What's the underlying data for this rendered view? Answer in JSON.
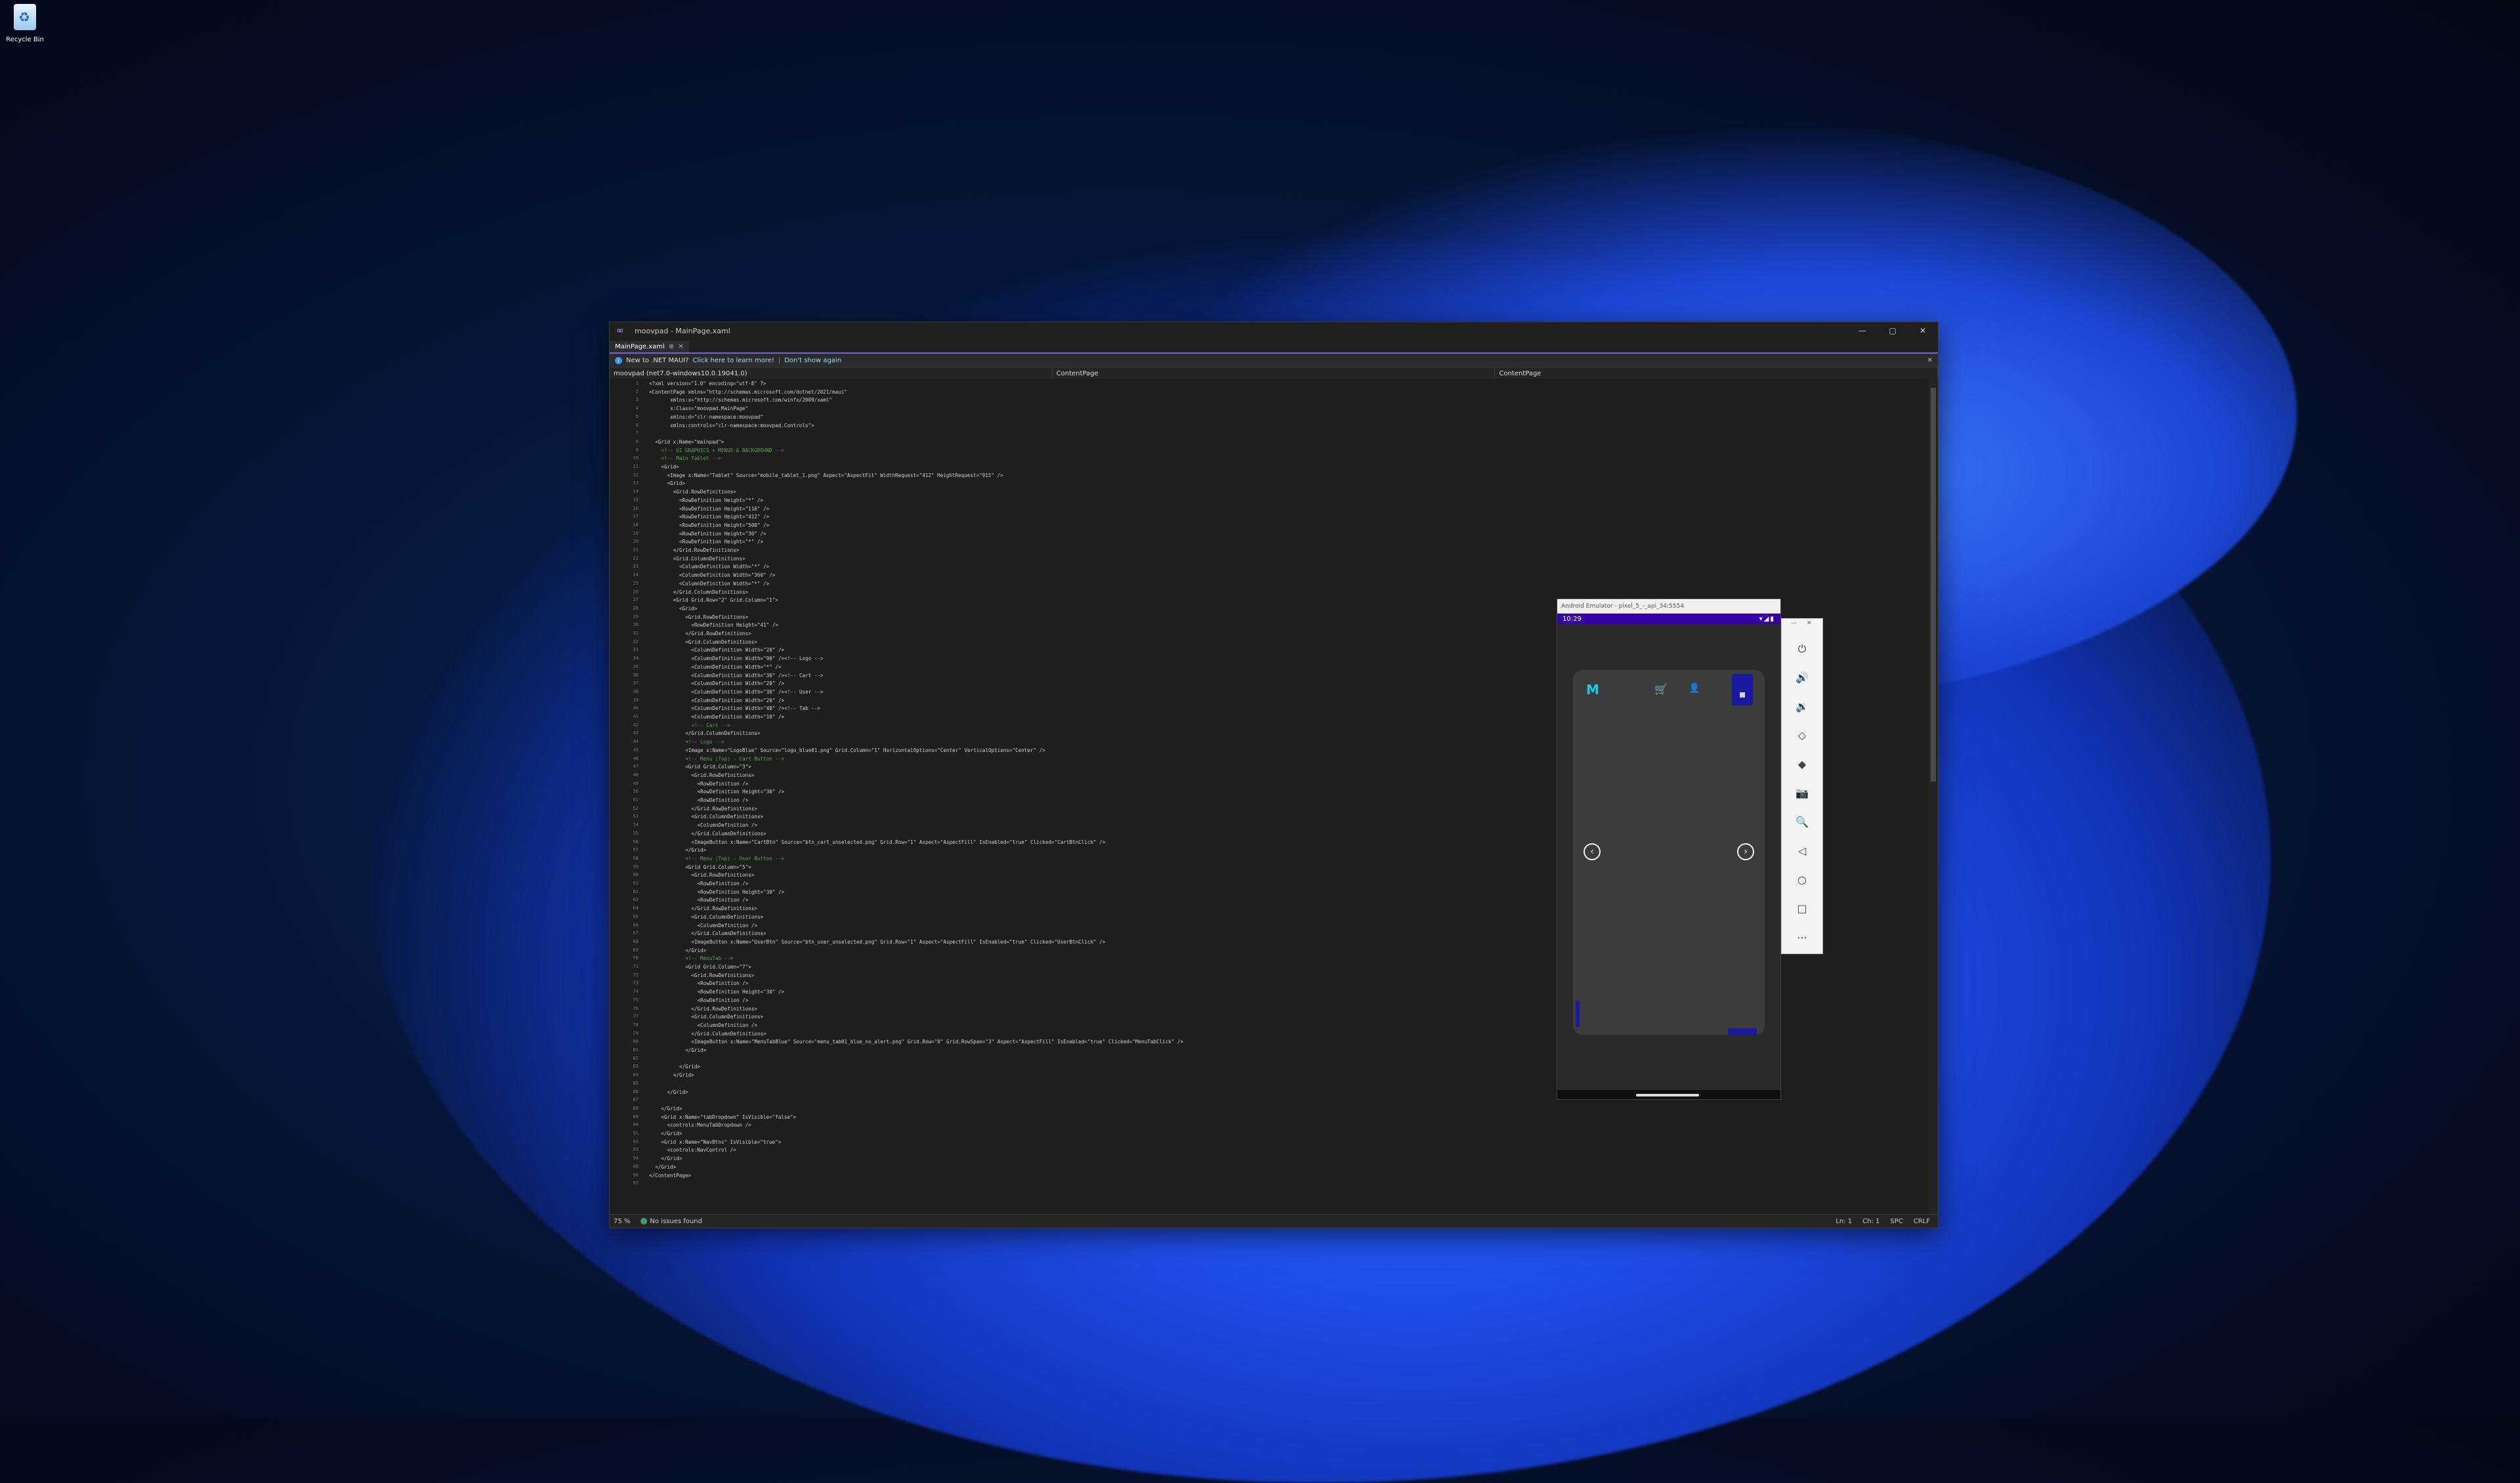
{
  "desktop": {
    "recycle_bin_label": "Recycle Bin"
  },
  "window": {
    "title": "moovpad - MainPage.xaml",
    "tab_label": "MainPage.xaml",
    "infobar": {
      "message": "New to .NET MAUI?",
      "link1": "Click here to learn more!",
      "separator": "|",
      "link2": "Don't show again"
    },
    "nav": {
      "project": "moovpad (net7.0-windows10.0.19041.0)",
      "type": "ContentPage",
      "member": "ContentPage"
    },
    "status": {
      "zoom": "75 %",
      "issues": "No issues found",
      "line": "Ln: 1",
      "col": "Ch: 1",
      "spc": "SPC",
      "eol": "CRLF"
    }
  },
  "code_lines": [
    {
      "n": "1",
      "t": "<?xml version=\"1.0\" encoding=\"utf-8\" ?>",
      "i": 0,
      "c": "tag"
    },
    {
      "n": "2",
      "t": "<ContentPage xmlns=\"http://schemas.microsoft.com/dotnet/2021/maui\"",
      "i": 0,
      "c": "tag"
    },
    {
      "n": "3",
      "t": "xmlns:x=\"http://schemas.microsoft.com/winfx/2009/xaml\"",
      "i": 7,
      "c": "tag"
    },
    {
      "n": "4",
      "t": "x:Class=\"moovpad.MainPage\"",
      "i": 7,
      "c": "tag"
    },
    {
      "n": "5",
      "t": "xmlns:d=\"clr-namespace:moovpad\"",
      "i": 7,
      "c": "tag"
    },
    {
      "n": "6",
      "t": "xmlns:controls=\"clr-namespace:moovpad.Controls\">",
      "i": 7,
      "c": "tag"
    },
    {
      "n": "7",
      "t": "",
      "i": 0,
      "c": "tag"
    },
    {
      "n": "8",
      "t": "<Grid x:Name=\"mainpad\">",
      "i": 2,
      "c": "tag"
    },
    {
      "n": "9",
      "t": "<!-- UI GRAPHICS + MENUS & BACKGROUND -->",
      "i": 4,
      "c": "cm"
    },
    {
      "n": "10",
      "t": "<!-- Main Tablet -->",
      "i": 4,
      "c": "cm"
    },
    {
      "n": "11",
      "t": "<Grid>",
      "i": 4,
      "c": "tag"
    },
    {
      "n": "12",
      "t": "<Image x:Name=\"Tablet\" Source=\"mobile_tablet_1.png\" Aspect=\"AspectFit\" WidthRequest=\"412\" HeightRequest=\"915\" />",
      "i": 6,
      "c": "tag"
    },
    {
      "n": "13",
      "t": "<Grid>",
      "i": 6,
      "c": "tag"
    },
    {
      "n": "14",
      "t": "<Grid.RowDefinitions>",
      "i": 8,
      "c": "tag"
    },
    {
      "n": "15",
      "t": "<RowDefinition Height=\"*\" />",
      "i": 10,
      "c": "tag"
    },
    {
      "n": "16",
      "t": "<RowDefinition Height=\"116\" />",
      "i": 10,
      "c": "tag"
    },
    {
      "n": "17",
      "t": "<RowDefinition Height=\"412\" />",
      "i": 10,
      "c": "tag"
    },
    {
      "n": "18",
      "t": "<RowDefinition Height=\"500\" />",
      "i": 10,
      "c": "tag"
    },
    {
      "n": "19",
      "t": "<RowDefinition Height=\"30\" />",
      "i": 10,
      "c": "tag"
    },
    {
      "n": "20",
      "t": "<RowDefinition Height=\"*\" />",
      "i": 10,
      "c": "tag"
    },
    {
      "n": "21",
      "t": "</Grid.RowDefinitions>",
      "i": 8,
      "c": "tag"
    },
    {
      "n": "22",
      "t": "<Grid.ColumnDefinitions>",
      "i": 8,
      "c": "tag"
    },
    {
      "n": "23",
      "t": "<ColumnDefinition Width=\"*\" />",
      "i": 10,
      "c": "tag"
    },
    {
      "n": "24",
      "t": "<ColumnDefinition Width=\"360\" />",
      "i": 10,
      "c": "tag"
    },
    {
      "n": "25",
      "t": "<ColumnDefinition Width=\"*\" />",
      "i": 10,
      "c": "tag"
    },
    {
      "n": "26",
      "t": "</Grid.ColumnDefinitions>",
      "i": 8,
      "c": "tag"
    },
    {
      "n": "27",
      "t": "<Grid Grid.Row=\"2\" Grid.Column=\"1\">",
      "i": 8,
      "c": "tag"
    },
    {
      "n": "28",
      "t": "<Grid>",
      "i": 10,
      "c": "tag"
    },
    {
      "n": "29",
      "t": "<Grid.RowDefinitions>",
      "i": 12,
      "c": "tag"
    },
    {
      "n": "30",
      "t": "<RowDefinition Height=\"41\" />",
      "i": 14,
      "c": "tag"
    },
    {
      "n": "31",
      "t": "</Grid.RowDefinitions>",
      "i": 12,
      "c": "tag"
    },
    {
      "n": "32",
      "t": "<Grid.ColumnDefinitions>",
      "i": 12,
      "c": "tag"
    },
    {
      "n": "33",
      "t": "<ColumnDefinition Width=\"20\" />",
      "i": 14,
      "c": "tag"
    },
    {
      "n": "34",
      "t": "<ColumnDefinition Width=\"90\" /><!-- Logo -->",
      "i": 14,
      "c": "tag"
    },
    {
      "n": "35",
      "t": "<ColumnDefinition Width=\"*\" />",
      "i": 14,
      "c": "tag"
    },
    {
      "n": "36",
      "t": "<ColumnDefinition Width=\"30\" /><!-- Cart -->",
      "i": 14,
      "c": "tag"
    },
    {
      "n": "37",
      "t": "<ColumnDefinition Width=\"20\" />",
      "i": 14,
      "c": "tag"
    },
    {
      "n": "38",
      "t": "<ColumnDefinition Width=\"30\" /><!-- User -->",
      "i": 14,
      "c": "tag"
    },
    {
      "n": "39",
      "t": "<ColumnDefinition Width=\"20\" />",
      "i": 14,
      "c": "tag"
    },
    {
      "n": "40",
      "t": "<ColumnDefinition Width=\"40\" /><!-- Tab -->",
      "i": 14,
      "c": "tag"
    },
    {
      "n": "41",
      "t": "<ColumnDefinition Width=\"10\" />",
      "i": 14,
      "c": "tag"
    },
    {
      "n": "42",
      "t": "<!-- Cart -->",
      "i": 14,
      "c": "cm"
    },
    {
      "n": "43",
      "t": "</Grid.ColumnDefinitions>",
      "i": 12,
      "c": "tag"
    },
    {
      "n": "44",
      "t": "<!-- Logo -->",
      "i": 12,
      "c": "cm"
    },
    {
      "n": "45",
      "t": "<Image x:Name=\"LogoBlue\" Source=\"logo_blue01.png\" Grid.Column=\"1\" HorizontalOptions=\"Center\" VerticalOptions=\"Center\" />",
      "i": 12,
      "c": "tag"
    },
    {
      "n": "46",
      "t": "<!-- Menu (Top) - Cart Button -->",
      "i": 12,
      "c": "cm"
    },
    {
      "n": "47",
      "t": "<Grid Grid.Column=\"3\">",
      "i": 12,
      "c": "tag"
    },
    {
      "n": "48",
      "t": "<Grid.RowDefinitions>",
      "i": 14,
      "c": "tag"
    },
    {
      "n": "49",
      "t": "<RowDefinition />",
      "i": 16,
      "c": "tag"
    },
    {
      "n": "50",
      "t": "<RowDefinition Height=\"30\" />",
      "i": 16,
      "c": "tag"
    },
    {
      "n": "51",
      "t": "<RowDefinition />",
      "i": 16,
      "c": "tag"
    },
    {
      "n": "52",
      "t": "</Grid.RowDefinitions>",
      "i": 14,
      "c": "tag"
    },
    {
      "n": "53",
      "t": "<Grid.ColumnDefinitions>",
      "i": 14,
      "c": "tag"
    },
    {
      "n": "54",
      "t": "<ColumnDefinition />",
      "i": 16,
      "c": "tag"
    },
    {
      "n": "55",
      "t": "</Grid.ColumnDefinitions>",
      "i": 14,
      "c": "tag"
    },
    {
      "n": "56",
      "t": "<ImageButton x:Name=\"CartBtn\" Source=\"btn_cart_unselected.png\" Grid.Row=\"1\" Aspect=\"AspectFill\" IsEnabled=\"true\" Clicked=\"CartBtnClick\" />",
      "i": 14,
      "c": "tag"
    },
    {
      "n": "57",
      "t": "</Grid>",
      "i": 12,
      "c": "tag"
    },
    {
      "n": "58",
      "t": "<!-- Menu (Top) - User Button -->",
      "i": 12,
      "c": "cm"
    },
    {
      "n": "59",
      "t": "<Grid Grid.Column=\"5\">",
      "i": 12,
      "c": "tag"
    },
    {
      "n": "60",
      "t": "<Grid.RowDefinitions>",
      "i": 14,
      "c": "tag"
    },
    {
      "n": "61",
      "t": "<RowDefinition />",
      "i": 16,
      "c": "tag"
    },
    {
      "n": "62",
      "t": "<RowDefinition Height=\"30\" />",
      "i": 16,
      "c": "tag"
    },
    {
      "n": "63",
      "t": "<RowDefinition />",
      "i": 16,
      "c": "tag"
    },
    {
      "n": "64",
      "t": "</Grid.RowDefinitions>",
      "i": 14,
      "c": "tag"
    },
    {
      "n": "65",
      "t": "<Grid.ColumnDefinitions>",
      "i": 14,
      "c": "tag"
    },
    {
      "n": "66",
      "t": "<ColumnDefinition />",
      "i": 16,
      "c": "tag"
    },
    {
      "n": "67",
      "t": "</Grid.ColumnDefinitions>",
      "i": 14,
      "c": "tag"
    },
    {
      "n": "68",
      "t": "<ImageButton x:Name=\"UserBtn\" Source=\"btn_user_unselected.png\" Grid.Row=\"1\" Aspect=\"AspectFill\" IsEnabled=\"true\" Clicked=\"UserBtnClick\" />",
      "i": 14,
      "c": "tag"
    },
    {
      "n": "69",
      "t": "</Grid>",
      "i": 12,
      "c": "tag"
    },
    {
      "n": "70",
      "t": "<!-- MenuTab -->",
      "i": 12,
      "c": "cm"
    },
    {
      "n": "71",
      "t": "<Grid Grid.Column=\"7\">",
      "i": 12,
      "c": "tag"
    },
    {
      "n": "72",
      "t": "<Grid.RowDefinitions>",
      "i": 14,
      "c": "tag"
    },
    {
      "n": "73",
      "t": "<RowDefinition />",
      "i": 16,
      "c": "tag"
    },
    {
      "n": "74",
      "t": "<RowDefinition Height=\"30\" />",
      "i": 16,
      "c": "tag"
    },
    {
      "n": "75",
      "t": "<RowDefinition />",
      "i": 16,
      "c": "tag"
    },
    {
      "n": "76",
      "t": "</Grid.RowDefinitions>",
      "i": 14,
      "c": "tag"
    },
    {
      "n": "77",
      "t": "<Grid.ColumnDefinitions>",
      "i": 14,
      "c": "tag"
    },
    {
      "n": "78",
      "t": "<ColumnDefinition />",
      "i": 16,
      "c": "tag"
    },
    {
      "n": "79",
      "t": "</Grid.ColumnDefinitions>",
      "i": 14,
      "c": "tag"
    },
    {
      "n": "80",
      "t": "<ImageButton x:Name=\"MenuTabBlue\" Source=\"menu_tab01_blue_no_alert.png\" Grid.Row=\"0\" Grid.RowSpan=\"3\" Aspect=\"AspectFill\" IsEnabled=\"true\" Clicked=\"MenuTabClick\" />",
      "i": 14,
      "c": "tag"
    },
    {
      "n": "81",
      "t": "</Grid>",
      "i": 12,
      "c": "tag"
    },
    {
      "n": "82",
      "t": "",
      "i": 0,
      "c": "tag"
    },
    {
      "n": "83",
      "t": "</Grid>",
      "i": 10,
      "c": "tag"
    },
    {
      "n": "84",
      "t": "</Grid>",
      "i": 8,
      "c": "tag"
    },
    {
      "n": "85",
      "t": "",
      "i": 0,
      "c": "tag"
    },
    {
      "n": "86",
      "t": "</Grid>",
      "i": 6,
      "c": "tag"
    },
    {
      "n": "87",
      "t": "",
      "i": 0,
      "c": "tag"
    },
    {
      "n": "88",
      "t": "</Grid>",
      "i": 4,
      "c": "tag"
    },
    {
      "n": "89",
      "t": "<Grid x:Name=\"tabDropdown\" IsVisible=\"false\">",
      "i": 4,
      "c": "tag"
    },
    {
      "n": "90",
      "t": "<controls:MenuTabDropdown />",
      "i": 6,
      "c": "tag"
    },
    {
      "n": "91",
      "t": "</Grid>",
      "i": 4,
      "c": "tag"
    },
    {
      "n": "92",
      "t": "<Grid x:Name=\"NavBtns\" IsVisible=\"true\">",
      "i": 4,
      "c": "tag"
    },
    {
      "n": "93",
      "t": "<controls:NavControl />",
      "i": 6,
      "c": "tag"
    },
    {
      "n": "94",
      "t": "</Grid>",
      "i": 4,
      "c": "tag"
    },
    {
      "n": "95",
      "t": "</Grid>",
      "i": 2,
      "c": "tag"
    },
    {
      "n": "96",
      "t": "</ContentPage>",
      "i": 0,
      "c": "tag"
    },
    {
      "n": "97",
      "t": "",
      "i": 0,
      "c": "tag"
    }
  ],
  "emulator": {
    "title": "Android Emulator - pixel_5_-_api_34:5554",
    "time": "10:29",
    "status_icons": "▾◢▮",
    "brand": "M",
    "side_icons": [
      "⏻",
      "🔊",
      "🔉",
      "◇",
      "◆",
      "📷",
      "🔍",
      "◁",
      "○",
      "□",
      "⋯"
    ]
  }
}
